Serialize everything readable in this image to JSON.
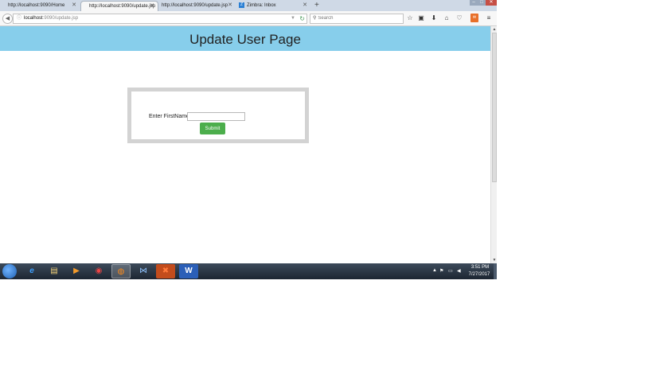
{
  "browser": {
    "tabs": [
      {
        "label": "http://localhost:9090/Home",
        "active": false
      },
      {
        "label": "http://localhost:9090/update.jsp",
        "active": true
      },
      {
        "label": "http://localhost:9090/update.jsp",
        "active": false
      },
      {
        "label": "Zimbra: Inbox",
        "active": false,
        "favicon": "Z"
      }
    ],
    "new_tab_symbol": "+",
    "url": {
      "host": "localhost",
      "path": ":9090/update.jsp"
    },
    "search": {
      "placeholder": "Search"
    }
  },
  "page": {
    "title": "Update User Page",
    "form": {
      "firstname_label": "Enter FirstName",
      "firstname_value": "",
      "submit_label": "Submit"
    },
    "colors": {
      "header": "#87ceeb",
      "submit": "#4cae4c",
      "form_border": "#d3d3d3"
    }
  },
  "taskbar": {
    "apps": [
      {
        "icon": "internet-explorer-icon",
        "glyph": "e"
      },
      {
        "icon": "file-explorer-icon",
        "glyph": "▤"
      },
      {
        "icon": "media-player-icon",
        "glyph": "▶"
      },
      {
        "icon": "chrome-icon",
        "glyph": "◉"
      },
      {
        "icon": "firefox-icon",
        "glyph": "◍",
        "active": true
      },
      {
        "icon": "visual-studio-icon",
        "glyph": "⋈"
      },
      {
        "icon": "xampp-icon",
        "glyph": "✖"
      },
      {
        "icon": "word-icon",
        "glyph": "W"
      }
    ],
    "tray": {
      "time": "3:51 PM",
      "date": "7/27/2017"
    }
  }
}
